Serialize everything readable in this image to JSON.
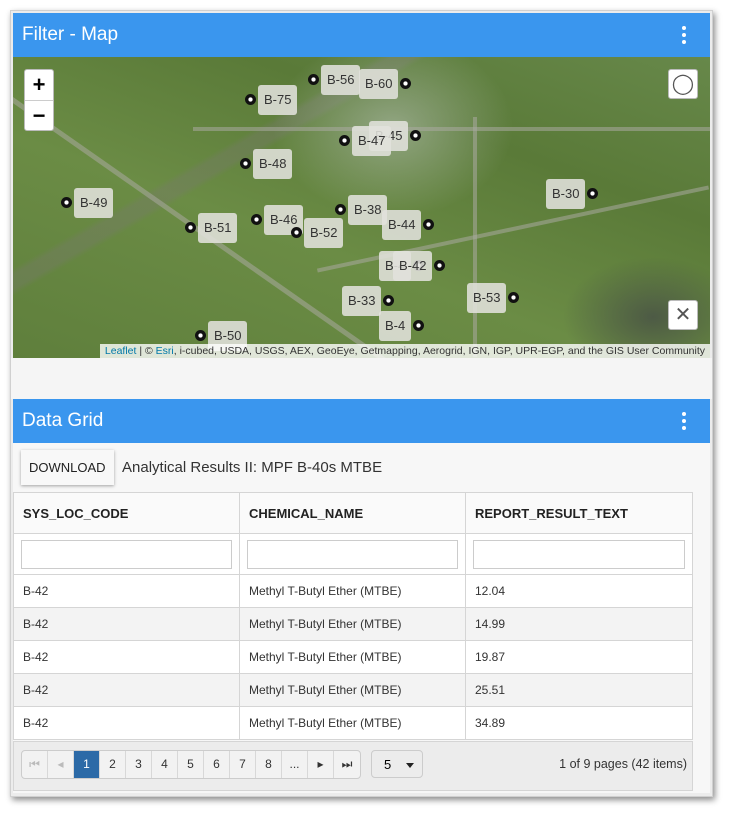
{
  "map_panel": {
    "title": "Filter - Map",
    "menu_icon": "kebab-icon",
    "zoom_in": "+",
    "zoom_out": "−",
    "lasso_icon": "lasso-icon",
    "clear_icon": "close-icon",
    "markers": [
      "B-56",
      "B-60",
      "B-75",
      "B-45",
      "B-47",
      "B-48",
      "B-49",
      "B-51",
      "B-46",
      "B-52",
      "B-38",
      "B-44",
      "B-30",
      "B-4",
      "B-42",
      "B-33",
      "B-53",
      "B-4",
      "B-50"
    ],
    "attribution": {
      "leaflet": "Leaflet",
      "sep": " | © ",
      "esri": "Esri",
      "rest": ", i-cubed, USDA, USGS, AEX, GeoEye, Getmapping, Aerogrid, IGN, IGP, UPR-EGP, and the GIS User Community"
    }
  },
  "grid_panel": {
    "title": "Data Grid",
    "download": "DOWNLOAD",
    "grid_title": "Analytical Results II: MPF B-40s MTBE",
    "columns": [
      "SYS_LOC_CODE",
      "CHEMICAL_NAME",
      "REPORT_RESULT_TEXT"
    ],
    "rows": [
      [
        "B-42",
        "Methyl T-Butyl Ether (MTBE)",
        "12.04"
      ],
      [
        "B-42",
        "Methyl T-Butyl Ether (MTBE)",
        "14.99"
      ],
      [
        "B-42",
        "Methyl T-Butyl Ether (MTBE)",
        "19.87"
      ],
      [
        "B-42",
        "Methyl T-Butyl Ether (MTBE)",
        "25.51"
      ],
      [
        "B-42",
        "Methyl T-Butyl Ether (MTBE)",
        "34.89"
      ]
    ],
    "pager": {
      "first": "⏮",
      "prev": "◂",
      "pages": [
        "1",
        "2",
        "3",
        "4",
        "5",
        "6",
        "7",
        "8",
        "..."
      ],
      "next": "▸",
      "last": "⏭",
      "page_size": "5",
      "info": "1 of 9 pages (42 items)"
    }
  },
  "colors": {
    "header": "#3a96ee",
    "current_page": "#2c6aa7"
  }
}
